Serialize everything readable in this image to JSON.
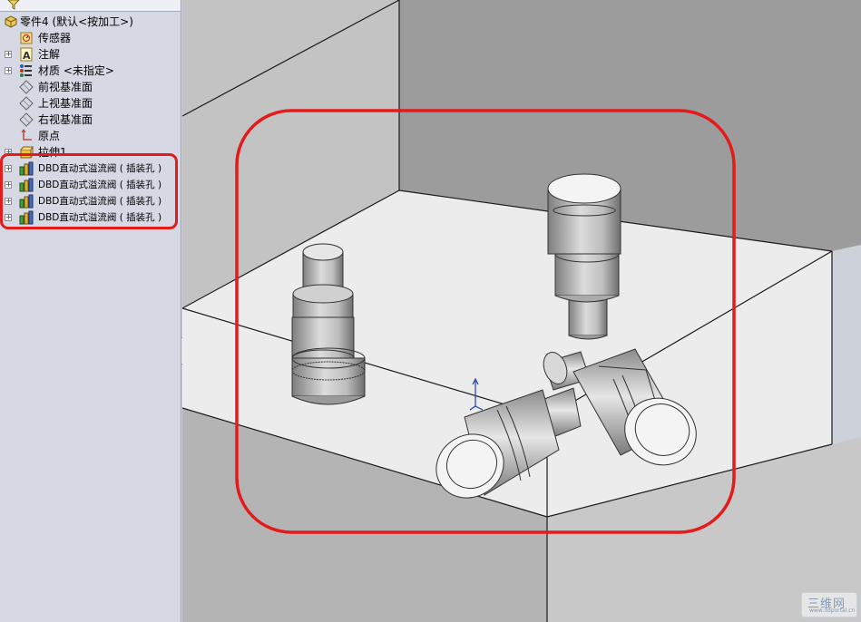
{
  "feature_tree": {
    "root": {
      "label": "零件4  (默认<按加工>)",
      "icon": "part-icon"
    },
    "items": [
      {
        "label": "传感器",
        "icon": "sensor-icon",
        "expandable": false
      },
      {
        "label": "注解",
        "icon": "annotation-icon",
        "expandable": true
      },
      {
        "label": "材质 <未指定>",
        "icon": "material-icon",
        "expandable": true
      },
      {
        "label": "前视基准面",
        "icon": "plane-icon",
        "expandable": false
      },
      {
        "label": "上视基准面",
        "icon": "plane-icon",
        "expandable": false
      },
      {
        "label": "右视基准面",
        "icon": "plane-icon",
        "expandable": false
      },
      {
        "label": "原点",
        "icon": "origin-icon",
        "expandable": false
      },
      {
        "label": "拉伸1",
        "icon": "extrude-icon",
        "expandable": true
      },
      {
        "label": "DBD直动式溢流阀 ( 插装孔 )",
        "icon": "library-feature-icon",
        "expandable": true
      },
      {
        "label": "DBD直动式溢流阀 ( 插装孔 )",
        "icon": "library-feature-icon",
        "expandable": true
      },
      {
        "label": "DBD直动式溢流阀 ( 插装孔 )",
        "icon": "library-feature-icon",
        "expandable": true
      },
      {
        "label": "DBD直动式溢流阀 ( 插装孔 )",
        "icon": "library-feature-icon",
        "expandable": true
      }
    ]
  },
  "highlight_color": "#e41b1b",
  "watermark": {
    "main": "三维网",
    "sub": "www.3dportal.cn"
  }
}
